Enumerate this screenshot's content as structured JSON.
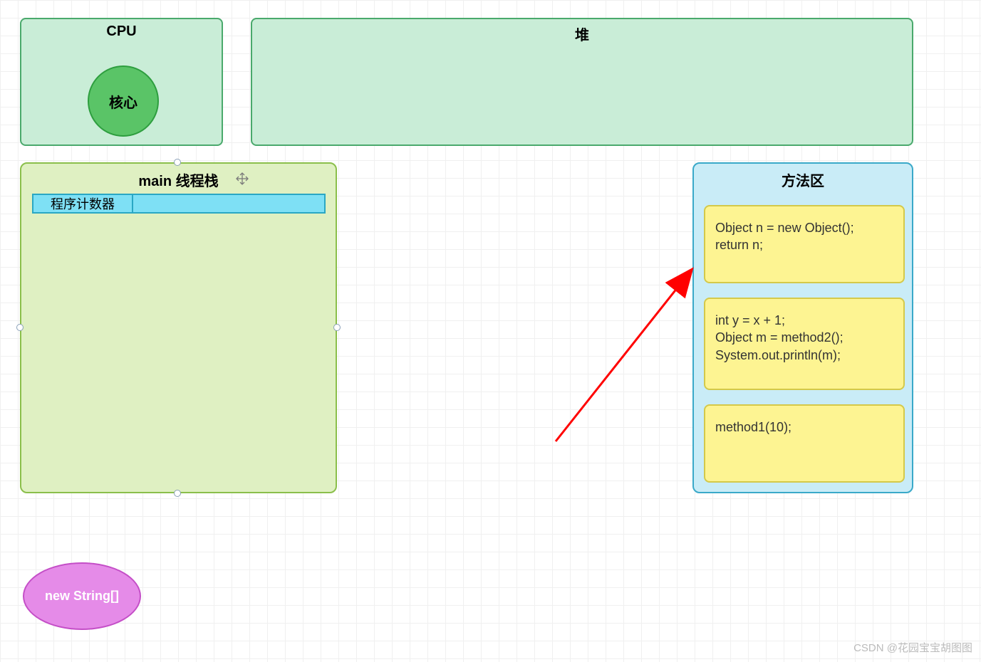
{
  "cpu": {
    "title": "CPU",
    "core_label": "核心"
  },
  "heap": {
    "title": "堆"
  },
  "stack": {
    "title": "main 线程栈",
    "pc_label": "程序计数器",
    "pc_value": ""
  },
  "method_area": {
    "title": "方法区",
    "blocks": [
      "Object n = new Object();\nreturn n;",
      "int y = x + 1;\nObject m = method2();\nSystem.out.println(m);",
      "method1(10);"
    ]
  },
  "new_string": {
    "label": "new String[]"
  },
  "watermark": "CSDN @花园宝宝胡图图",
  "colors": {
    "cpu_bg": "#c9edd7",
    "cpu_border": "#4aa96c",
    "core_bg": "#5ac467",
    "core_border": "#2e9e3f",
    "stack_bg": "#dff0c2",
    "stack_border": "#8bbf4b",
    "pc_bg": "#7ee0f5",
    "pc_border": "#2aa7c4",
    "method_bg": "#c9ecf7",
    "method_border": "#3aa9c9",
    "code_bg": "#fdf492",
    "code_border": "#d4c94a",
    "ellipse_bg": "#e58be8",
    "ellipse_border": "#c44ec7",
    "arrow": "#ff0000"
  }
}
